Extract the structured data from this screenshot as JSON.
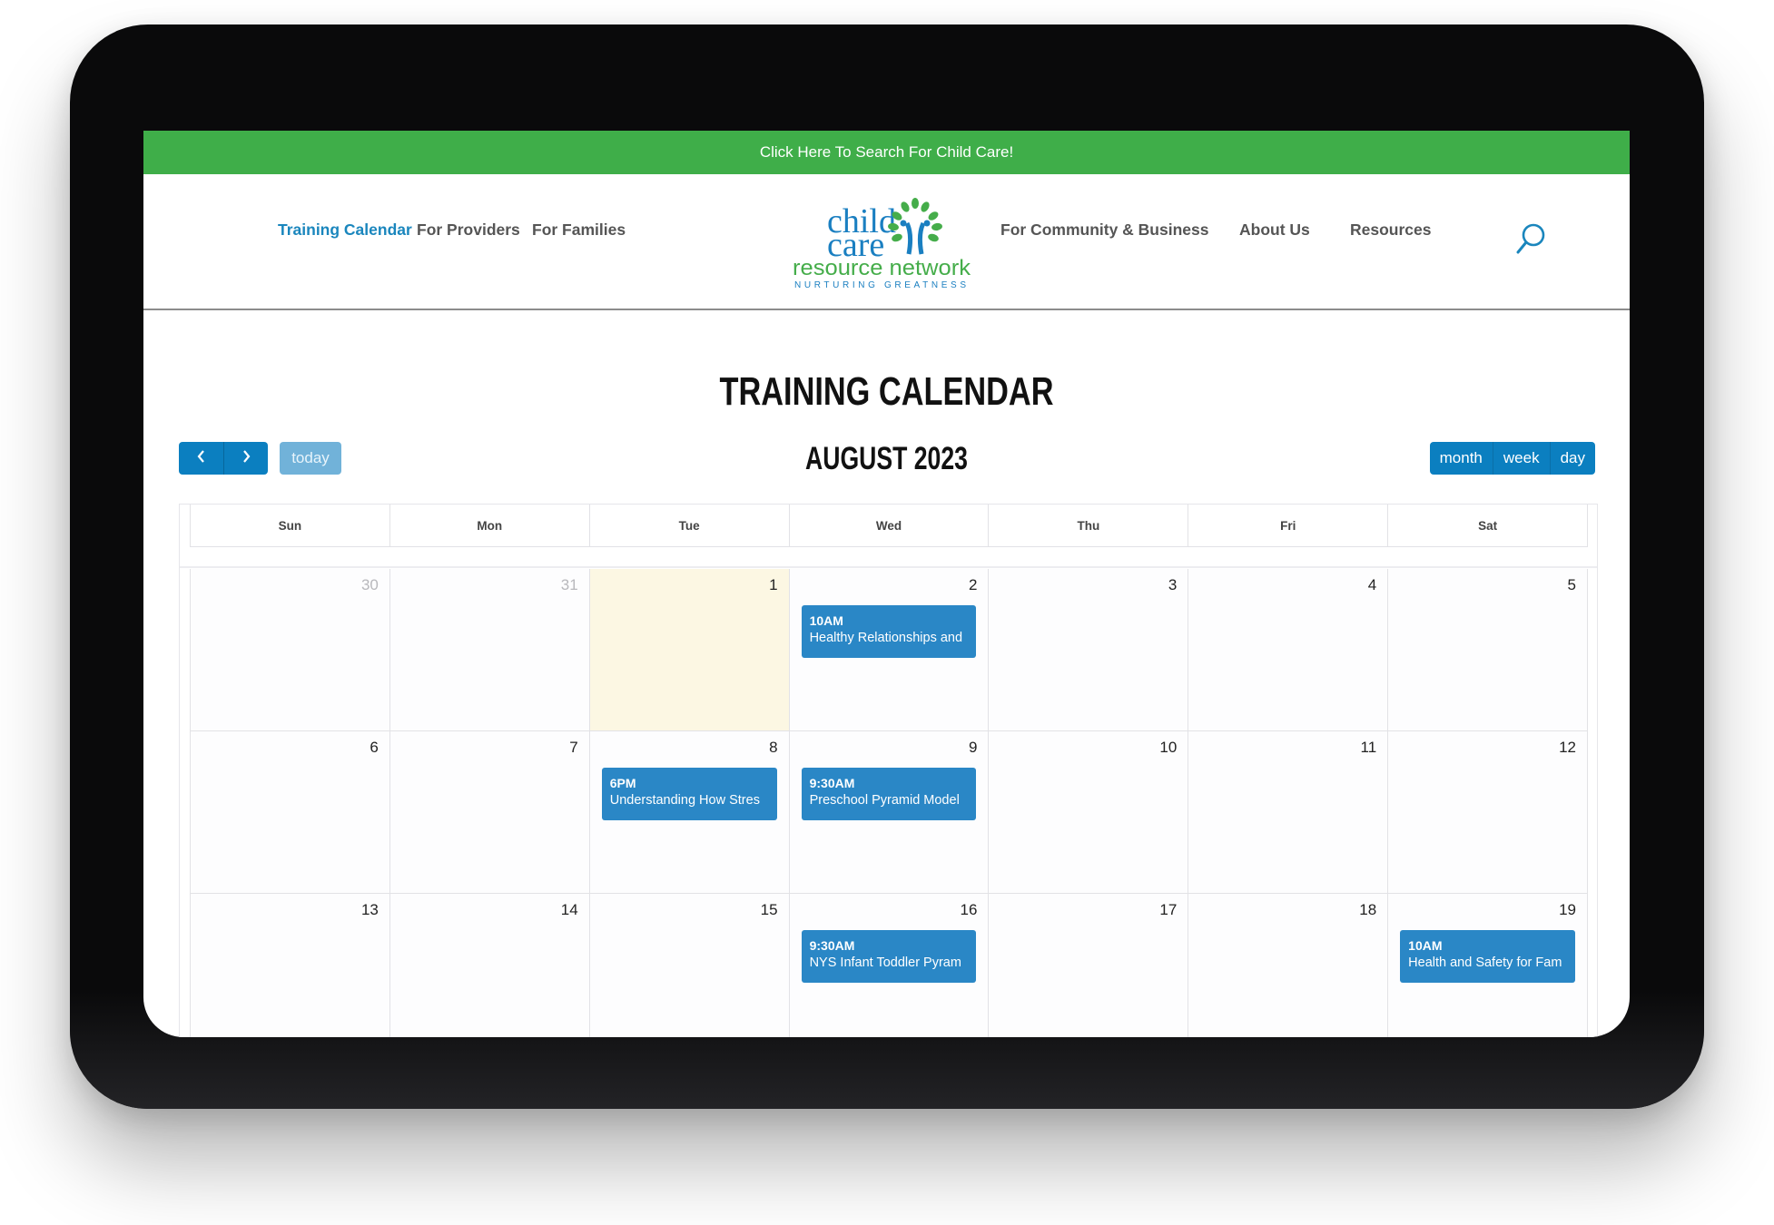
{
  "promo_bar": {
    "text": "Click Here To Search For Child Care!",
    "color": "#3fae49"
  },
  "nav": {
    "items": [
      {
        "label": "Training Calendar",
        "active": true
      },
      {
        "label": "For Providers",
        "active": false
      },
      {
        "label": "For Families",
        "active": false
      },
      {
        "label": "For Community & Business",
        "active": false
      },
      {
        "label": "About Us",
        "active": false
      },
      {
        "label": "Resources",
        "active": false
      }
    ],
    "search_icon": "search-icon",
    "active_color": "#1a86bd"
  },
  "logo": {
    "line1": "child",
    "line2": "care",
    "line3": "resource network",
    "tagline": "Nurturing Greatness",
    "blue": "#1a7fc1",
    "green": "#45ad4a"
  },
  "page_title": "TRAINING CALENDAR",
  "toolbar": {
    "prev_icon": "chevron-left-icon",
    "next_icon": "chevron-right-icon",
    "prev_glyph": "‹",
    "next_glyph": "›",
    "today_label": "today",
    "month_title": "AUGUST 2023",
    "views": [
      "month",
      "week",
      "day"
    ],
    "active_view": "month"
  },
  "calendar": {
    "weekdays": [
      "Sun",
      "Mon",
      "Tue",
      "Wed",
      "Thu",
      "Fri",
      "Sat"
    ],
    "today": "1",
    "weeks": [
      [
        {
          "day": "30",
          "other_month": true
        },
        {
          "day": "31",
          "other_month": true
        },
        {
          "day": "1",
          "today": true
        },
        {
          "day": "2",
          "events": [
            {
              "time": "10AM",
              "title": "Healthy Relationships and"
            }
          ]
        },
        {
          "day": "3"
        },
        {
          "day": "4"
        },
        {
          "day": "5"
        }
      ],
      [
        {
          "day": "6"
        },
        {
          "day": "7"
        },
        {
          "day": "8",
          "events": [
            {
              "time": "6PM",
              "title": "Understanding How Stres"
            }
          ]
        },
        {
          "day": "9",
          "events": [
            {
              "time": "9:30AM",
              "title": "Preschool Pyramid Model"
            }
          ]
        },
        {
          "day": "10"
        },
        {
          "day": "11"
        },
        {
          "day": "12"
        }
      ],
      [
        {
          "day": "13"
        },
        {
          "day": "14"
        },
        {
          "day": "15"
        },
        {
          "day": "16",
          "events": [
            {
              "time": "9:30AM",
              "title": "NYS Infant Toddler Pyram"
            }
          ]
        },
        {
          "day": "17"
        },
        {
          "day": "18"
        },
        {
          "day": "19",
          "events": [
            {
              "time": "10AM",
              "title": "Health and Safety for Fam"
            }
          ]
        }
      ]
    ],
    "event_color": "#2a87c6",
    "today_color": "#fcf7e3"
  }
}
